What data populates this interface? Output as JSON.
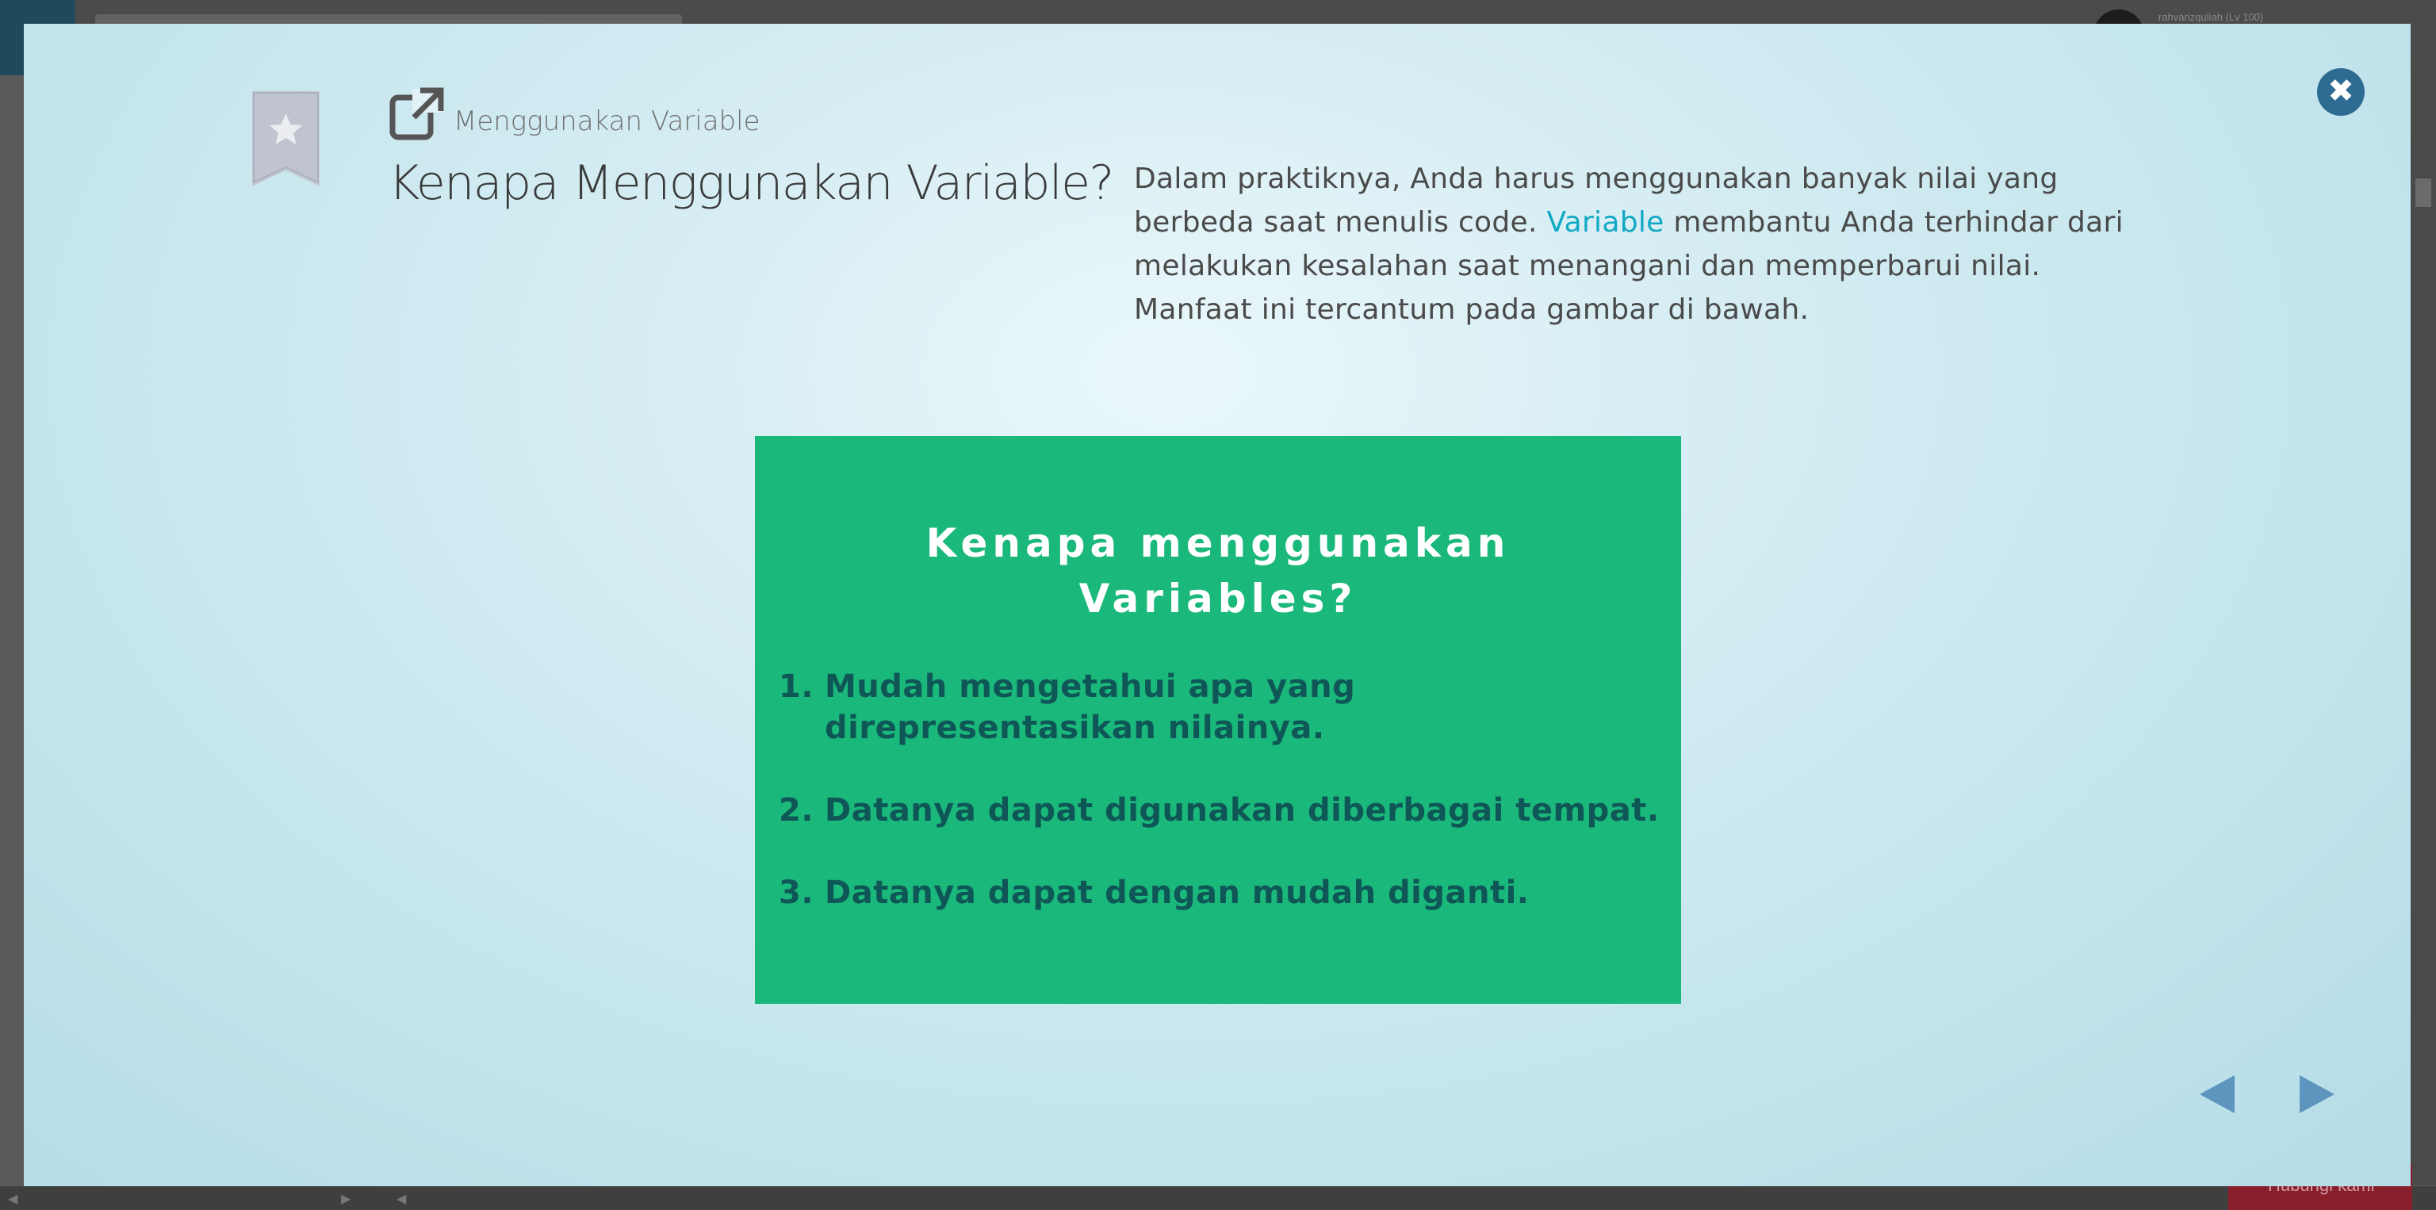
{
  "background": {
    "username": "rahvarizquliah (Lv 100)",
    "cta_button": "Hubungi kami"
  },
  "modal": {
    "breadcrumb": "Menggunakan Variable",
    "title": "Kenapa Menggunakan Variable?",
    "description": {
      "part1": "Dalam praktiknya, Anda harus menggunakan banyak nilai yang berbeda saat menulis code. ",
      "highlight": "Variable",
      "part2": " membantu Anda terhindar dari melakukan kesalahan saat menangani dan memperbarui nilai. Manfaat ini tercantum pada gambar di bawah."
    },
    "close_symbol": "✖",
    "slide": {
      "title_line1": "Kenapa menggunakan",
      "title_line2": "Variables?",
      "items": [
        {
          "num": "1.",
          "text": "Mudah mengetahui apa yang direpresentasikan nilainya."
        },
        {
          "num": "2.",
          "text": "Datanya dapat digunakan diberbagai tempat."
        },
        {
          "num": "3.",
          "text": "Datanya dapat dengan mudah diganti."
        }
      ]
    }
  },
  "colors": {
    "slide_bg": "#1ab87b",
    "slide_text": "#0f5757",
    "link": "#12a9c5",
    "close_btn": "#2d6b93",
    "nav_arrows": "#5e95be"
  }
}
